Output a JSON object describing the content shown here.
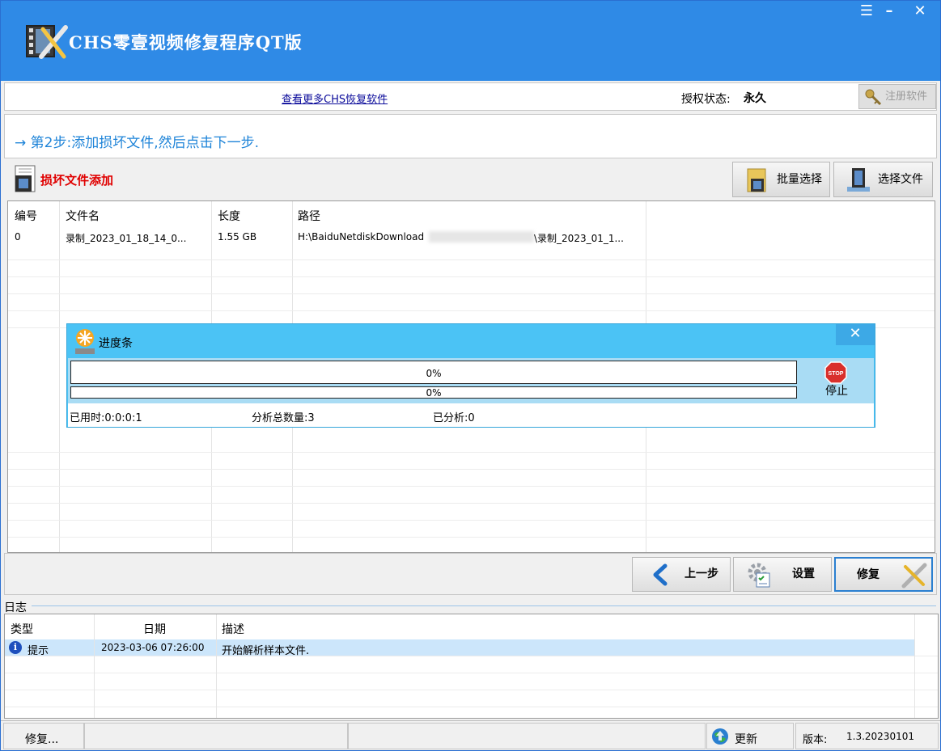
{
  "app": {
    "title": "CHS零壹视频修复程序QT版"
  },
  "topbar": {
    "more_link": "查看更多CHS恢复软件",
    "license_label": "授权状态:",
    "license_value": "永久",
    "register_label": "注册软件"
  },
  "step": {
    "text": "→ 第2步:添加损坏文件,然后点击下一步."
  },
  "files": {
    "title": "损坏文件添加",
    "batch_select_label": "批量选择",
    "select_file_label": "选择文件",
    "columns": [
      "编号",
      "文件名",
      "长度",
      "路径"
    ],
    "rows": [
      {
        "id": "0",
        "name": "录制_2023_01_18_14_0...",
        "size": "1.55 GB",
        "path": "H:\\BaiduNetdiskDownload",
        "path_tail": "\\录制_2023_01_1..."
      }
    ]
  },
  "progress": {
    "title": "进度条",
    "bar1_percent": 0,
    "bar1_label": "0%",
    "bar2_percent": 0,
    "bar2_label": "0%",
    "stop_label": "停止",
    "elapsed": "已用时:0:0:0:1",
    "total": "分析总数量:3",
    "analyzed": "已分析:0"
  },
  "nav": {
    "prev_label": "上一步",
    "settings_label": "设置",
    "repair_label": "修复"
  },
  "log": {
    "label": "日志",
    "columns": [
      "类型",
      "日期",
      "描述"
    ],
    "rows": [
      {
        "type": "提示",
        "date": "2023-03-06 07:26:00",
        "desc": "开始解析样本文件."
      }
    ]
  },
  "status": {
    "left": "修复...",
    "update_label": "更新",
    "version_label": "版本:",
    "version_value": "1.3.20230101"
  },
  "colors": {
    "titlebar": "#2f8ae6",
    "step_text": "#1f84d8",
    "files_title": "#e00000",
    "progress_bg": "#4bc3f5"
  }
}
